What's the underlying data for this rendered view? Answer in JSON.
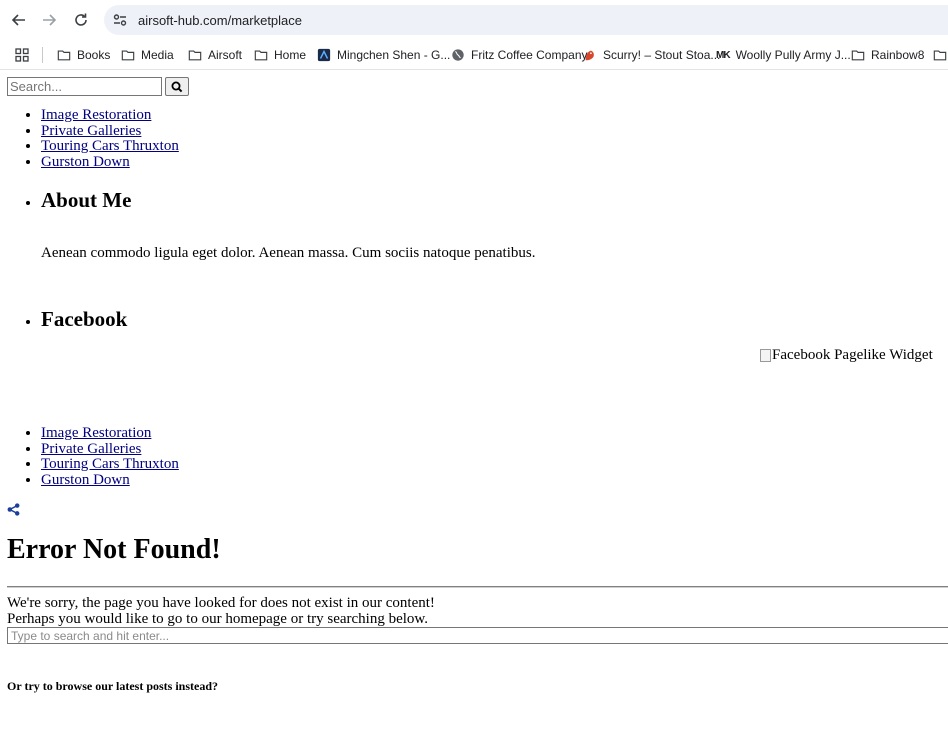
{
  "browser": {
    "url": "airsoft-hub.com/marketplace",
    "bookmarks": [
      {
        "label": "Books",
        "icon": "folder-icon"
      },
      {
        "label": "Media",
        "icon": "folder-icon"
      },
      {
        "label": "Airsoft",
        "icon": "folder-icon"
      },
      {
        "label": "Home",
        "icon": "folder-icon"
      },
      {
        "label": "Mingchen Shen - G...",
        "icon": "site-icon"
      },
      {
        "label": "Fritz Coffee Company",
        "icon": "globe-icon"
      },
      {
        "label": "Scurry! – Stout Stoa...",
        "icon": "scurry-icon"
      },
      {
        "label": "Woolly Pully Army J...",
        "icon": "mk-icon",
        "mark": "MK"
      },
      {
        "label": "Rainbow8",
        "icon": "folder-icon"
      }
    ]
  },
  "header": {
    "search_placeholder": "Search...",
    "nav_links": [
      "Image Restoration",
      "Private Galleries",
      "Touring Cars Thruxton",
      "Gurston Down"
    ]
  },
  "sidebar": {
    "about_title": "About Me",
    "about_text": "Aenean commodo ligula eget dolor. Aenean massa. Cum sociis natoque penatibus.",
    "facebook_title": "Facebook",
    "facebook_widget_alt": "Facebook Pagelike Widget"
  },
  "footer": {
    "nav_links": [
      "Image Restoration",
      "Private Galleries",
      "Touring Cars Thruxton",
      "Gurston Down"
    ]
  },
  "content": {
    "error_title": "Error Not Found!",
    "error_line1": "We're sorry, the page you have looked for does not exist in our content!",
    "error_line2": "Perhaps you would like to go to our homepage or try searching below.",
    "search_placeholder": "Type to search and hit enter...",
    "browse_text": "Or try to browse our latest posts instead?"
  },
  "colors": {
    "link": "#000080",
    "omnibox": "#eef1f8",
    "share_icon": "#1c3f9c"
  }
}
